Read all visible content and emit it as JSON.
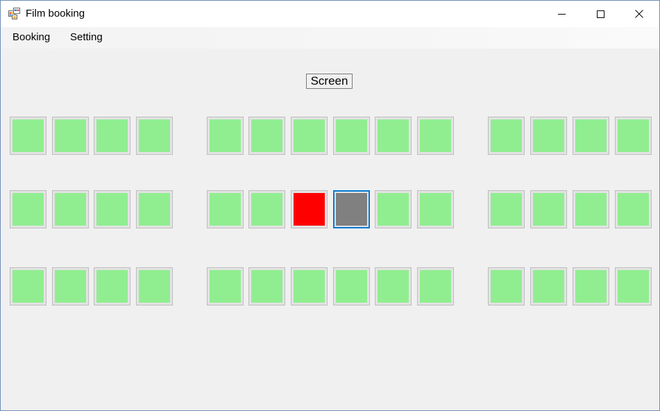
{
  "window": {
    "title": "Film booking",
    "icon": "winforms-app-icon",
    "controls": [
      "minimize-icon",
      "maximize-icon",
      "close-icon"
    ]
  },
  "menu": {
    "items": [
      {
        "label": "Booking"
      },
      {
        "label": "Setting"
      }
    ]
  },
  "screen_label": "Screen",
  "colors": {
    "available": "#90ee90",
    "booked": "#ff0000",
    "selected": "#808080",
    "focus_border": "#0078d7"
  },
  "seating": {
    "rows": [
      {
        "seats": [
          "available",
          "available",
          "available",
          "available",
          "available",
          "available",
          "available",
          "available",
          "available",
          "available",
          "available",
          "available",
          "available",
          "available"
        ]
      },
      {
        "seats": [
          "available",
          "available",
          "available",
          "available",
          "available",
          "available",
          "booked",
          "selected",
          "available",
          "available",
          "available",
          "available",
          "available",
          "available"
        ]
      },
      {
        "seats": [
          "available",
          "available",
          "available",
          "available",
          "available",
          "available",
          "available",
          "available",
          "available",
          "available",
          "available",
          "available",
          "available",
          "available"
        ]
      }
    ],
    "focused": {
      "row": 1,
      "seat": 7
    }
  }
}
